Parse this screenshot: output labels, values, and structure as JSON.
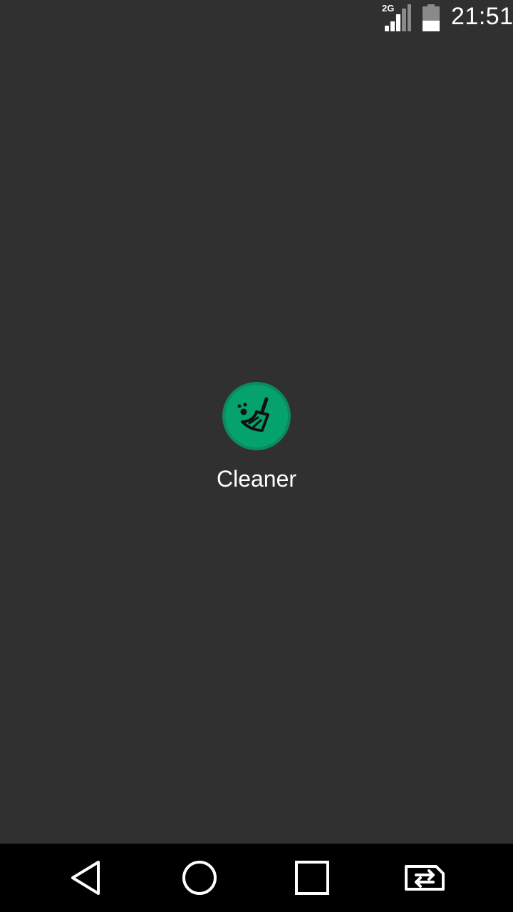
{
  "status_bar": {
    "network_type": "2G",
    "time": "21:51",
    "signal_icon": "cellular-signal-icon",
    "battery_icon": "battery-icon"
  },
  "launcher": {
    "app_name": "Cleaner",
    "app_icon": "broom-icon",
    "icon_color": "#06a26e"
  },
  "nav_bar": {
    "back": "back-triangle-icon",
    "home": "home-circle-icon",
    "recents": "recents-square-icon",
    "switch": "sim-switch-icon"
  },
  "colors": {
    "background": "#303030",
    "nav_background": "#000000",
    "text": "#ffffff"
  }
}
